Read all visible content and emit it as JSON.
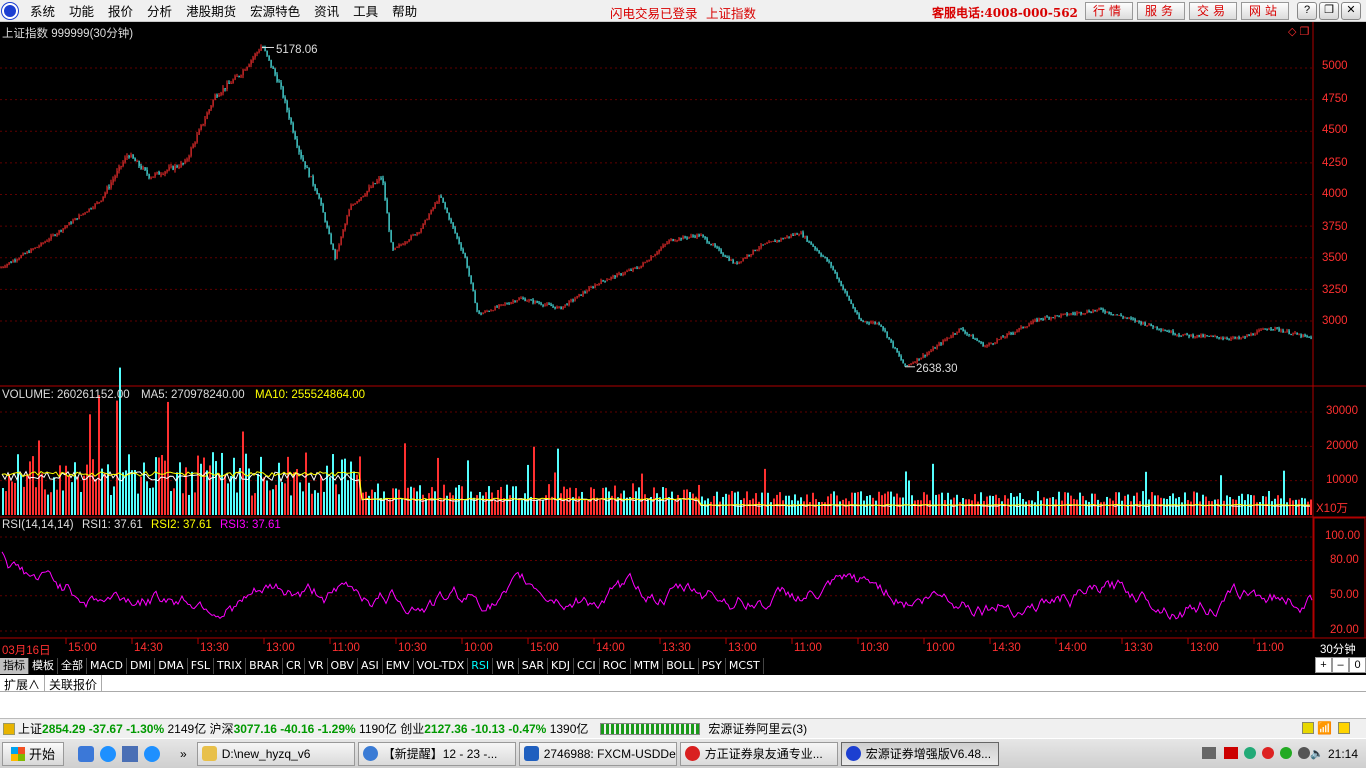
{
  "menubar": {
    "items": [
      "系统",
      "功能",
      "报价",
      "分析",
      "港股期货",
      "宏源特色",
      "资讯",
      "工具",
      "帮助"
    ],
    "login_status": "闪电交易已登录",
    "current_index": "上证指数",
    "hotline": "客服电话:4008-000-562",
    "buttons": [
      "行情",
      "服务",
      "交易",
      "网站"
    ],
    "window_controls": [
      "?",
      "–",
      "❐",
      "✕"
    ]
  },
  "chart": {
    "title": "上证指数  999999(30分钟)",
    "annotation_high": "5178.06",
    "annotation_low": "2638.30",
    "price_axis_ticks": [
      "5000",
      "4750",
      "4500",
      "4250",
      "4000",
      "3750",
      "3500",
      "3250",
      "3000"
    ],
    "volume_header": {
      "volume": "VOLUME: 260261152.00",
      "ma5": "MA5: 270978240.00",
      "ma10": "MA10: 255524864.00"
    },
    "volume_axis_ticks": [
      "30000",
      "20000",
      "10000"
    ],
    "volume_unit": "X10万",
    "rsi_header": {
      "params": "RSI(14,14,14)",
      "rsi1": "RSI1: 37.61",
      "rsi2": "RSI2: 37.61",
      "rsi3": "RSI3: 37.61"
    },
    "rsi_axis_ticks": [
      "100.00",
      "80.00",
      "50.00",
      "20.00"
    ],
    "time_axis": [
      "03月16日",
      "15:00",
      "14:30",
      "13:30",
      "13:00",
      "11:00",
      "10:30",
      "10:00",
      "15:00",
      "14:00",
      "13:30",
      "13:00",
      "11:00",
      "10:30",
      "10:00",
      "14:30",
      "14:00",
      "13:30",
      "13:00",
      "11:00"
    ],
    "period_label": "30分钟",
    "colors": {
      "up": "#ff3030",
      "down": "#54ffff",
      "grid": "#600000",
      "axis": "#b00000",
      "ma5": "#ffffff",
      "ma10": "#ffff00",
      "rsi": "#ff00ff"
    }
  },
  "indicator_tabs": [
    "指标",
    "模板",
    "全部",
    "MACD",
    "DMI",
    "DMA",
    "FSL",
    "TRIX",
    "BRAR",
    "CR",
    "VR",
    "OBV",
    "ASI",
    "EMV",
    "VOL-TDX",
    "RSI",
    "WR",
    "SAR",
    "KDJ",
    "CCI",
    "ROC",
    "MTM",
    "BOLL",
    "PSY",
    "MCST"
  ],
  "indicator_active": "RSI",
  "ctrl_buttons": [
    "+",
    "–",
    "0"
  ],
  "sub_tabs": [
    "扩展∧",
    "关联报价"
  ],
  "statusbar": {
    "sh_name": "上证",
    "sh_price": "2854.29",
    "sh_change": "-37.67",
    "sh_pct": "-1.30%",
    "sh_amount": "2149亿",
    "sz_name": "沪深",
    "sz_price": "3077.16",
    "sz_change": "-40.16",
    "sz_pct": "-1.29%",
    "sz_amount": "1190亿",
    "cy_name": "创业",
    "cy_price": "2127.36",
    "cy_change": "-10.13",
    "cy_pct": "-0.47%",
    "cy_amount": "1390亿",
    "server": "宏源证券阿里云(3)"
  },
  "taskbar": {
    "start": "开始",
    "tasks": [
      "D:\\new_hyzq_v6",
      "【新提醒】12 - 23 -...",
      "2746988: FXCM-USDDe...",
      "方正证券泉友通专业...",
      "宏源证券增强版V6.48..."
    ],
    "clock": "21:14"
  }
}
